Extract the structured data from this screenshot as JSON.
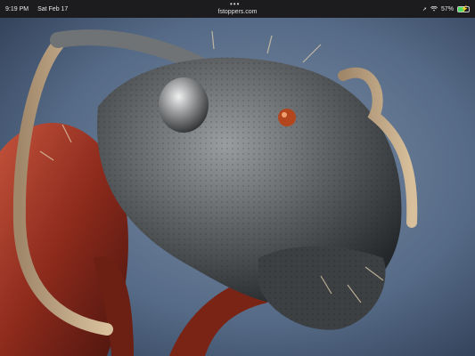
{
  "status_bar": {
    "time": "9:19 PM",
    "date": "Sat Feb 17",
    "url": "fstoppers.com",
    "multitask": "•••",
    "battery_percent": "57%",
    "battery_level": 0.57,
    "icons": [
      "location-icon",
      "wifi-icon",
      "battery-icon"
    ]
  },
  "photo": {
    "subject": "macro photograph of an ant head"
  },
  "colors": {
    "background": "#556a86",
    "ant_head": "#6e7173",
    "ant_body": "#8c2a1c",
    "status_bar": "#1c1c1e"
  }
}
